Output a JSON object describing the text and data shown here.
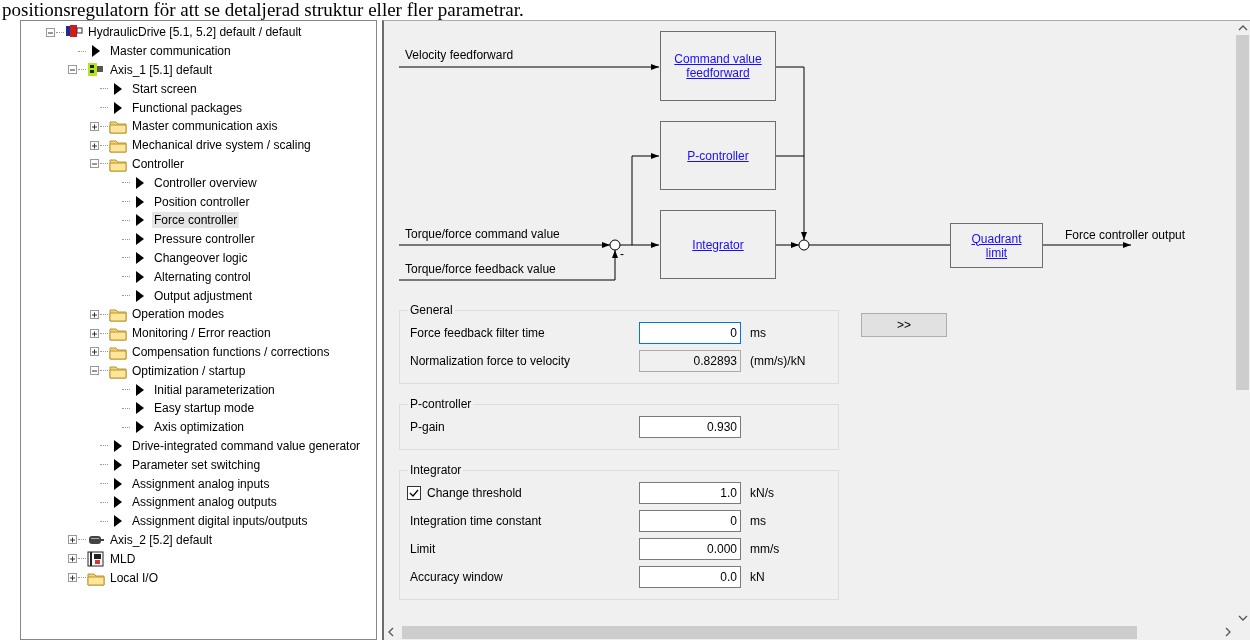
{
  "caption": "positionsregulatorn för att se detaljerad struktur eller fler parametrar.",
  "tree": [
    {
      "label": "HydraulicDrive [5.1, 5.2] default / default",
      "kind": "drive",
      "expanded": true,
      "selected": false,
      "children": [
        {
          "label": "Master communication",
          "kind": "page",
          "selected": false
        },
        {
          "label": "Axis_1 [5.1] default",
          "kind": "axis-active",
          "expanded": true,
          "selected": false,
          "children": [
            {
              "label": "Start screen",
              "kind": "page",
              "selected": false
            },
            {
              "label": "Functional packages",
              "kind": "page",
              "selected": false
            },
            {
              "label": "Master communication axis",
              "kind": "folder",
              "expanded": false,
              "selected": false
            },
            {
              "label": "Mechanical drive system / scaling",
              "kind": "folder",
              "expanded": false,
              "selected": false
            },
            {
              "label": "Controller",
              "kind": "folder",
              "expanded": true,
              "selected": false,
              "children": [
                {
                  "label": "Controller overview",
                  "kind": "page",
                  "selected": false
                },
                {
                  "label": "Position controller",
                  "kind": "page",
                  "selected": false
                },
                {
                  "label": "Force controller",
                  "kind": "page",
                  "selected": true
                },
                {
                  "label": "Pressure controller",
                  "kind": "page",
                  "selected": false
                },
                {
                  "label": "Changeover logic",
                  "kind": "page",
                  "selected": false
                },
                {
                  "label": "Alternating control",
                  "kind": "page",
                  "selected": false
                },
                {
                  "label": "Output adjustment",
                  "kind": "page",
                  "selected": false
                }
              ]
            },
            {
              "label": "Operation modes",
              "kind": "folder",
              "expanded": false,
              "selected": false
            },
            {
              "label": "Monitoring / Error reaction",
              "kind": "folder",
              "expanded": false,
              "selected": false
            },
            {
              "label": "Compensation functions / corrections",
              "kind": "folder",
              "expanded": false,
              "selected": false
            },
            {
              "label": "Optimization / startup",
              "kind": "folder",
              "expanded": true,
              "selected": false,
              "children": [
                {
                  "label": "Initial parameterization",
                  "kind": "page",
                  "selected": false
                },
                {
                  "label": "Easy startup mode",
                  "kind": "page",
                  "selected": false
                },
                {
                  "label": "Axis optimization",
                  "kind": "page",
                  "selected": false
                }
              ]
            },
            {
              "label": "Drive-integrated command value generator",
              "kind": "page",
              "selected": false
            },
            {
              "label": "Parameter set switching",
              "kind": "page",
              "selected": false
            },
            {
              "label": "Assignment analog inputs",
              "kind": "page",
              "selected": false
            },
            {
              "label": "Assignment analog outputs",
              "kind": "page",
              "selected": false
            },
            {
              "label": "Assignment digital inputs/outputs",
              "kind": "page",
              "selected": false
            }
          ]
        },
        {
          "label": "Axis_2 [5.2] default",
          "kind": "axis",
          "expanded": false,
          "selected": false
        },
        {
          "label": "MLD",
          "kind": "mld",
          "expanded": false,
          "selected": false
        },
        {
          "label": "Local I/O",
          "kind": "folder",
          "expanded": false,
          "selected": false
        }
      ]
    }
  ],
  "diagram": {
    "inputs": [
      "Velocity feedforward",
      "Torque/force command value",
      "Torque/force feedback value"
    ],
    "blocks": [
      "Command value feedforward",
      "P-controller",
      "Integrator",
      "Quadrant limit"
    ],
    "minus": "-",
    "output": "Force controller output"
  },
  "groups": [
    {
      "title": "General",
      "fields": [
        {
          "kind": "input",
          "label": "Force feedback filter time",
          "value": "0",
          "unit": "ms",
          "focused": true
        },
        {
          "kind": "readonly",
          "label": "Normalization force to velocity",
          "value": "0.82893",
          "unit": "(mm/s)/kN",
          "focused": false
        }
      ]
    },
    {
      "title": "P-controller",
      "fields": [
        {
          "kind": "input",
          "label": "P-gain",
          "value": "0.930",
          "focused": false
        }
      ]
    },
    {
      "title": "Integrator",
      "fields": [
        {
          "kind": "checkbox",
          "label": "Change threshold",
          "checked": true,
          "value": "1.0",
          "unit": "kN/s",
          "focused": false
        },
        {
          "kind": "input",
          "label": "Integration time constant",
          "value": "0",
          "unit": "ms",
          "focused": false
        },
        {
          "kind": "input",
          "label": "Limit",
          "value": "0.000",
          "unit": "mm/s",
          "focused": false
        },
        {
          "kind": "input",
          "label": "Accuracy window",
          "value": "0.0",
          "unit": "kN",
          "focused": false
        }
      ]
    }
  ],
  "expand_button": ">>"
}
